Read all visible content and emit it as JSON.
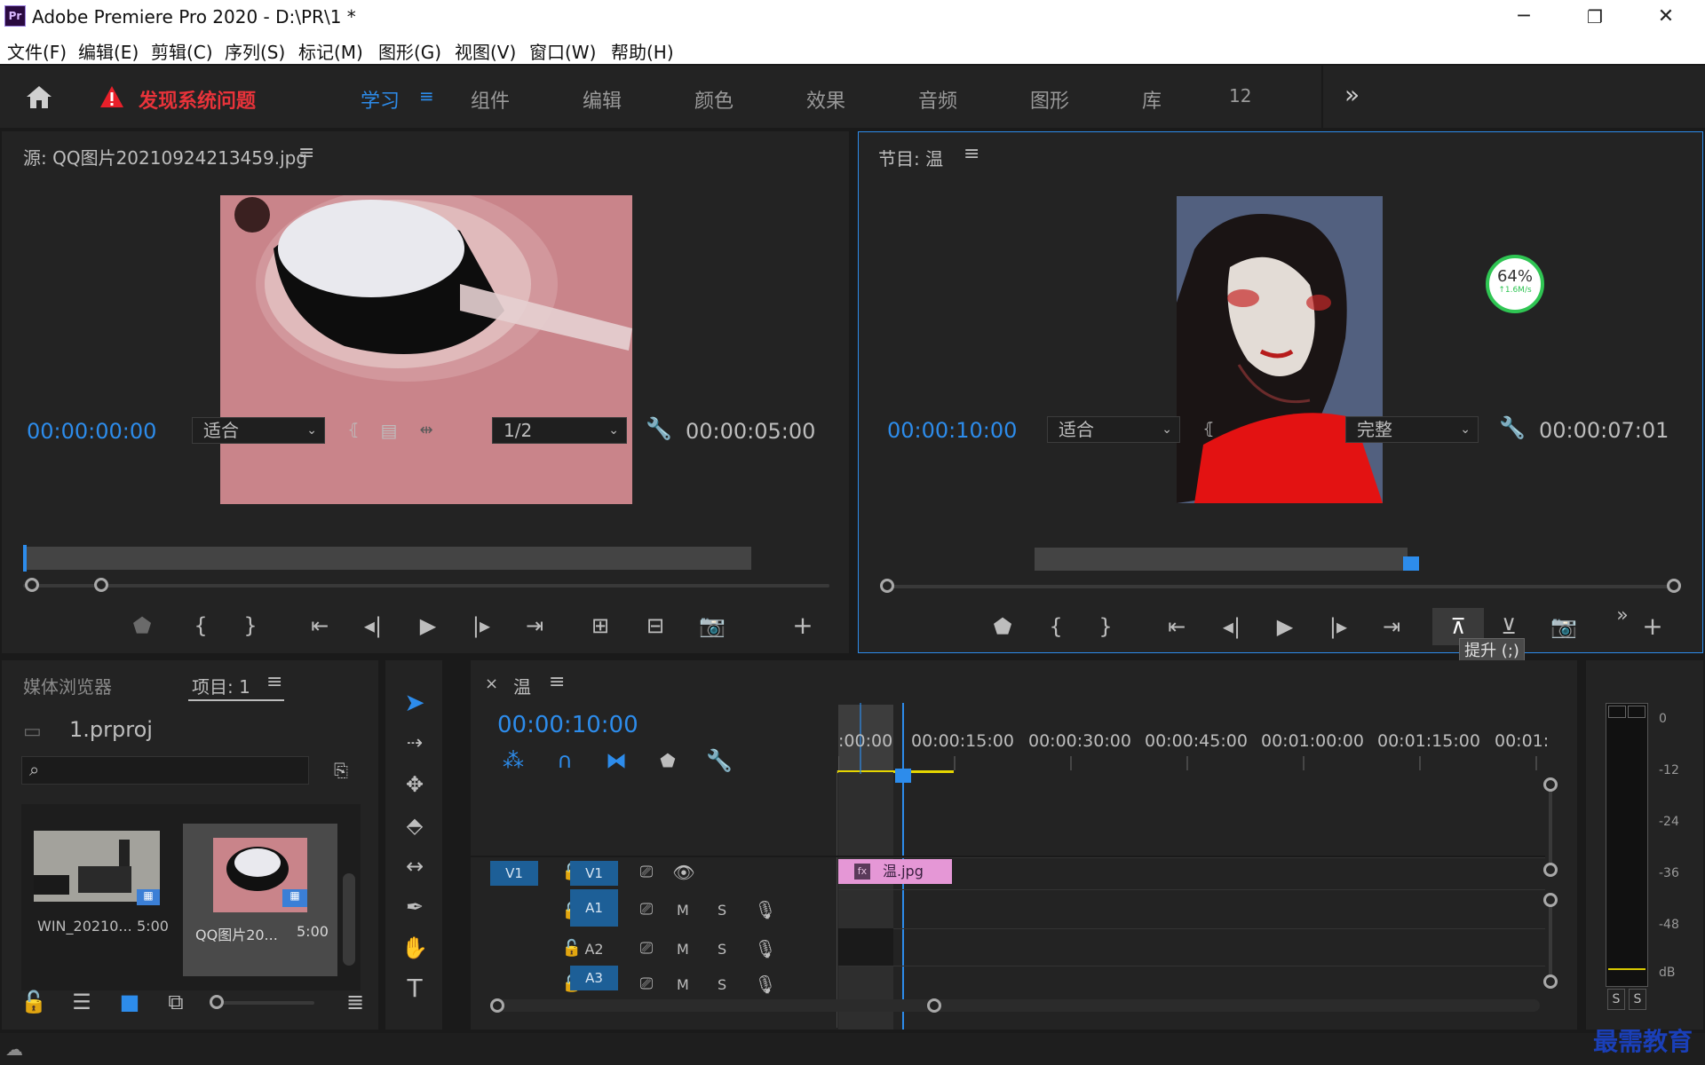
{
  "titlebar": {
    "logo": "Pr",
    "title": "Adobe Premiere Pro 2020 - D:\\PR\\1 *",
    "min": "─",
    "max": "❐",
    "close": "✕"
  },
  "menu": [
    "文件(F)",
    "编辑(E)",
    "剪辑(C)",
    "序列(S)",
    "标记(M)",
    "图形(G)",
    "视图(V)",
    "窗口(W)",
    "帮助(H)"
  ],
  "workspace": {
    "warning": "发现系统问题",
    "tabs": [
      "学习",
      "组件",
      "编辑",
      "颜色",
      "效果",
      "音频",
      "图形",
      "库",
      "12"
    ],
    "active_tab": "学习",
    "more": "»"
  },
  "source": {
    "title": "源: QQ图片20210924213459.jpg",
    "timecode": "00:00:00:00",
    "fit": "适合",
    "resolution": "1/2",
    "duration": "00:00:05:00"
  },
  "program": {
    "title": "节目: 温",
    "timecode": "00:00:10:00",
    "fit": "适合",
    "quality": "完整",
    "duration": "00:00:07:01",
    "tooltip": "提升 (;)",
    "overlay_percent": "64%",
    "overlay_speed": "↑1.6M/s"
  },
  "project": {
    "tab_media": "媒体浏览器",
    "tab_project": "项目: 1",
    "file": "1.prproj",
    "items": [
      {
        "name": "WIN_20210...",
        "duration": "5:00"
      },
      {
        "name": "QQ图片20...",
        "duration": "5:00"
      }
    ]
  },
  "timeline": {
    "close": "×",
    "title": "温",
    "timecode": "00:00:10:00",
    "ruler": [
      ":00:00",
      "00:00:15:00",
      "00:00:30:00",
      "00:00:45:00",
      "00:01:00:00",
      "00:01:15:00",
      "00:01:"
    ],
    "tracks": [
      {
        "src": "V1",
        "tgt": "V1",
        "type": "video"
      },
      {
        "src": "",
        "tgt": "A1",
        "type": "audio"
      },
      {
        "src": "",
        "tgt": "A2",
        "type": "audio"
      },
      {
        "src": "",
        "tgt": "A3",
        "type": "audio"
      }
    ],
    "clip": {
      "fx": "fx",
      "name": "温.jpg"
    },
    "m": "M",
    "s": "S"
  },
  "meters": {
    "labels": [
      "0",
      "-12",
      "-24",
      "-36",
      "-48",
      "dB"
    ],
    "solo": [
      "S",
      "S"
    ]
  },
  "watermark": "最需教育"
}
